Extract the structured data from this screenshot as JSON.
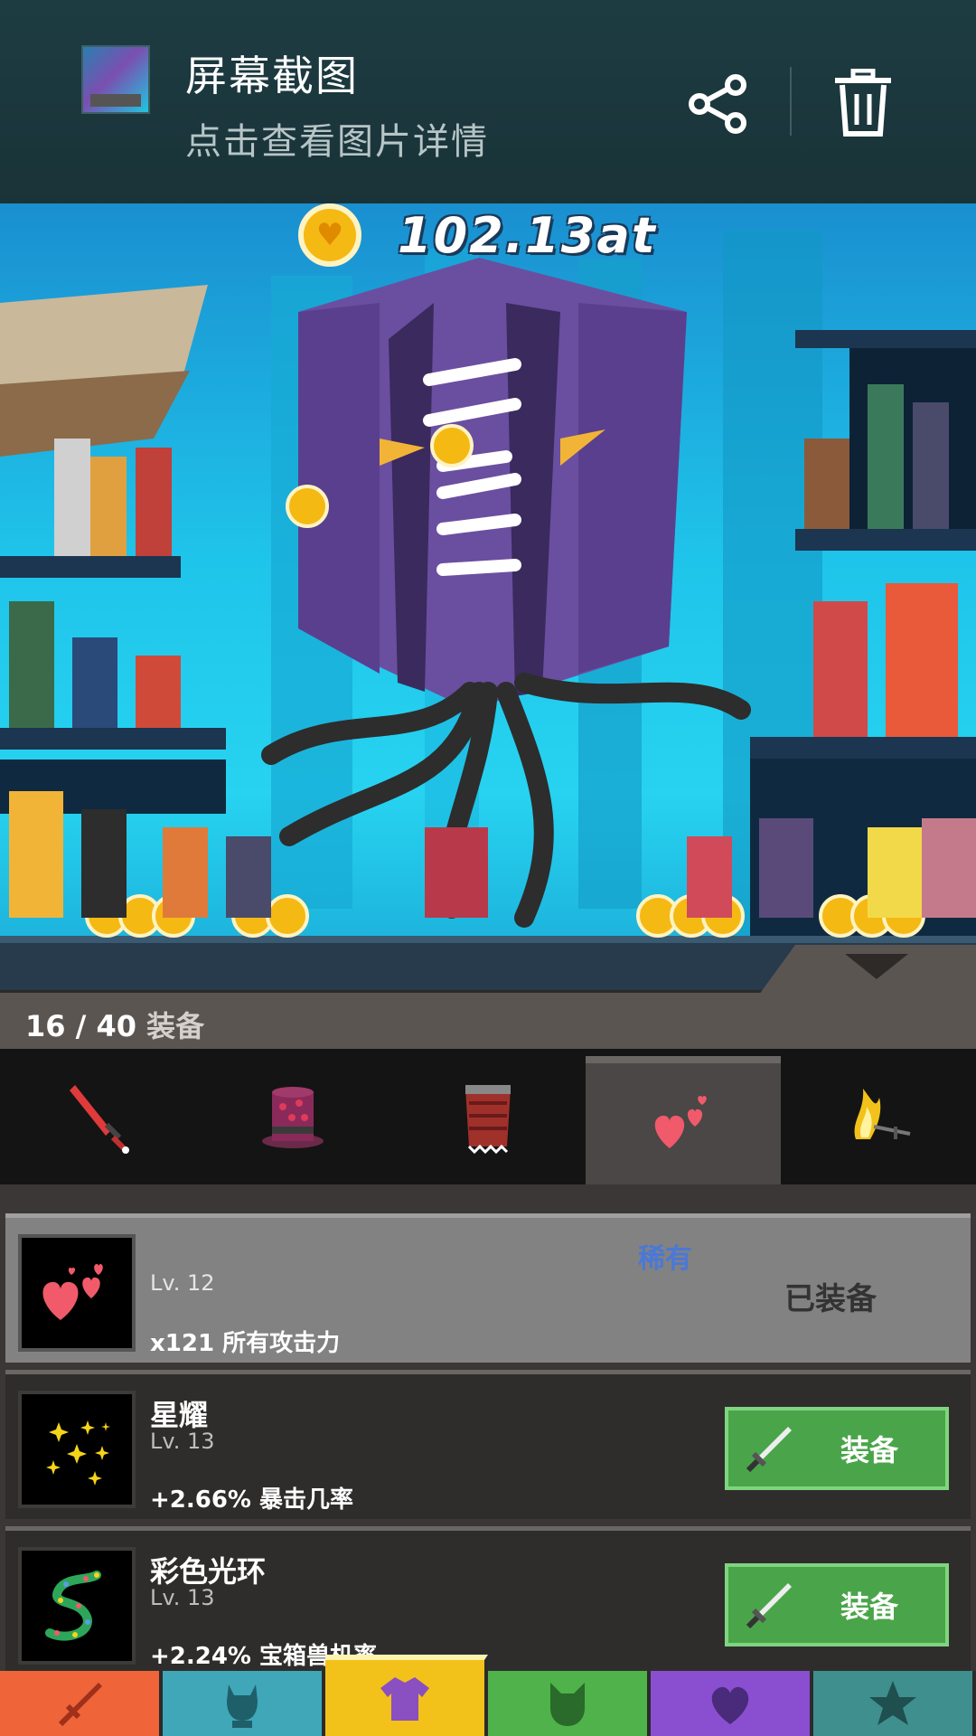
{
  "notification": {
    "title": "屏幕截图",
    "subtitle": "点击查看图片详情",
    "share_icon": "share-icon",
    "delete_icon": "trash-icon"
  },
  "game": {
    "currency_amount": "102.13at",
    "currency_icon": "heart-coin-icon"
  },
  "equipment": {
    "owned": "16",
    "separator": "/",
    "total": "40",
    "label": "装备"
  },
  "tabs": [
    {
      "icon": "sword-icon",
      "active": false
    },
    {
      "icon": "top-hat-icon",
      "active": false
    },
    {
      "icon": "armor-icon",
      "active": false
    },
    {
      "icon": "hearts-icon",
      "active": true
    },
    {
      "icon": "flame-sword-icon",
      "active": false
    }
  ],
  "items": [
    {
      "name": "",
      "rarity": "稀有",
      "level": "Lv. 12",
      "effect": "x121 所有攻击力",
      "status": "已装备",
      "icon": "hearts-icon",
      "equipped": true
    },
    {
      "name": "星耀",
      "level": "Lv. 13",
      "effect": "+2.66% 暴击几率",
      "button": "装备",
      "icon": "stars-icon",
      "equipped": false
    },
    {
      "name": "彩色光环",
      "level": "Lv. 13",
      "effect": "+2.24% 宝箱兽机率",
      "button": "装备",
      "icon": "rainbow-trail-icon",
      "equipped": false
    }
  ],
  "bottom_nav": [
    {
      "icon": "sword-icon",
      "color": "#f0643a"
    },
    {
      "icon": "hero-icon",
      "color": "#3fa7b8"
    },
    {
      "icon": "shirt-icon",
      "color": "#f2c21a",
      "active": true
    },
    {
      "icon": "pet-icon",
      "color": "#4fb24a"
    },
    {
      "icon": "heart-icon",
      "color": "#8a4fd0"
    },
    {
      "icon": "star-icon",
      "color": "#3f8f8f"
    }
  ]
}
